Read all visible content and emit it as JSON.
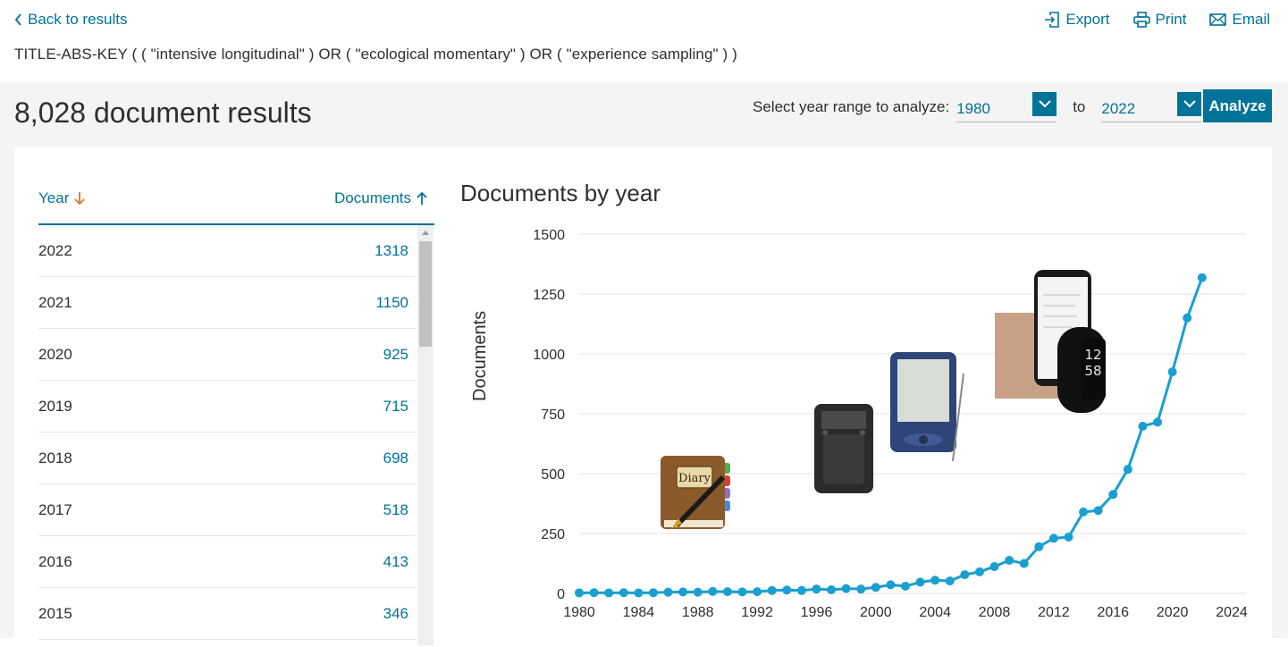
{
  "nav": {
    "back_label": "Back to results"
  },
  "actions": {
    "export": "Export",
    "print": "Print",
    "email": "Email"
  },
  "query": "TITLE-ABS-KEY ( ( \"intensive longitudinal\" )  OR  ( \"ecological momentary\" )  OR  ( \"experience sampling\" ) )",
  "results": {
    "title": "8,028 document results"
  },
  "range": {
    "label": "Select year range to analyze:",
    "from": "1980",
    "to_label": "to",
    "to": "2022",
    "analyze_label": "Analyze"
  },
  "table": {
    "col_year": "Year",
    "col_docs": "Documents",
    "rows": [
      {
        "year": "2022",
        "docs": "1318"
      },
      {
        "year": "2021",
        "docs": "1150"
      },
      {
        "year": "2020",
        "docs": "925"
      },
      {
        "year": "2019",
        "docs": "715"
      },
      {
        "year": "2018",
        "docs": "698"
      },
      {
        "year": "2017",
        "docs": "518"
      },
      {
        "year": "2016",
        "docs": "413"
      },
      {
        "year": "2015",
        "docs": "346"
      }
    ]
  },
  "chart_data": {
    "type": "line",
    "title": "Documents by year",
    "ylabel": "Documents",
    "xlabel": "",
    "ylim": [
      0,
      1500
    ],
    "xlim": [
      1980,
      2024
    ],
    "yticks": [
      "0",
      "250",
      "500",
      "750",
      "1000",
      "1250",
      "1500"
    ],
    "xticks": [
      "1980",
      "1984",
      "1988",
      "1992",
      "1996",
      "2000",
      "2004",
      "2008",
      "2012",
      "2016",
      "2020",
      "2024"
    ],
    "grid": true,
    "color": "#1a9fd0",
    "series": [
      {
        "x": [
          1980,
          1981,
          1982,
          1983,
          1984,
          1985,
          1986,
          1987,
          1988,
          1989,
          1990,
          1991,
          1992,
          1993,
          1994,
          1995,
          1996,
          1997,
          1998,
          1999,
          2000,
          2001,
          2002,
          2003,
          2004,
          2005,
          2006,
          2007,
          2008,
          2009,
          2010,
          2011,
          2012,
          2013,
          2014,
          2015,
          2016,
          2017,
          2018,
          2019,
          2020,
          2021,
          2022
        ],
        "values": [
          2,
          3,
          2,
          3,
          2,
          3,
          5,
          6,
          5,
          8,
          7,
          6,
          7,
          12,
          14,
          12,
          18,
          15,
          20,
          18,
          25,
          36,
          30,
          47,
          55,
          52,
          78,
          90,
          112,
          138,
          125,
          195,
          230,
          235,
          340,
          346,
          413,
          518,
          698,
          715,
          925,
          1150,
          1318
        ]
      }
    ]
  },
  "illustrations": [
    "diary-icon",
    "pager-icon",
    "pda-icon",
    "smartphone-smartwatch-icon"
  ]
}
